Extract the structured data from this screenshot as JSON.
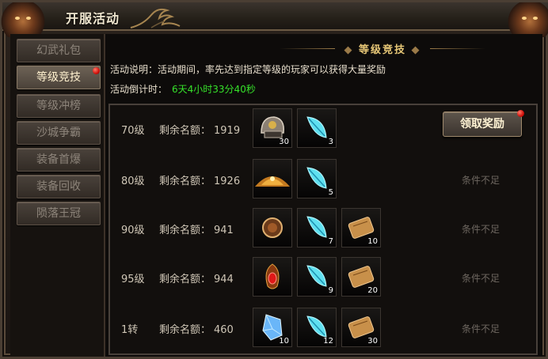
{
  "window": {
    "title": "开服活动"
  },
  "sidebar": {
    "items": [
      {
        "label": "幻武礼包",
        "active": false
      },
      {
        "label": "等级竞技",
        "active": true,
        "badge": true
      },
      {
        "label": "等级冲榜",
        "active": false
      },
      {
        "label": "沙城争霸",
        "active": false
      },
      {
        "label": "装备首爆",
        "active": false
      },
      {
        "label": "装备回收",
        "active": false
      },
      {
        "label": "陨落王冠",
        "active": false
      }
    ]
  },
  "panel": {
    "heading": "等级竞技",
    "description": "活动说明：活动期间，率先达到指定等级的玩家可以获得大量奖励",
    "countdown_label": "活动倒计时：",
    "countdown_value": "6天4小时33分40秒"
  },
  "rows": [
    {
      "level": "70级",
      "quota_label": "剩余名额：",
      "quota": "1919",
      "rewards": [
        {
          "icon": "helmet-icon",
          "count": "30"
        },
        {
          "icon": "feather-icon",
          "count": "3"
        }
      ],
      "action": {
        "type": "button",
        "label": "领取奖励",
        "badge": true
      }
    },
    {
      "level": "80级",
      "quota_label": "剩余名额：",
      "quota": "1926",
      "rewards": [
        {
          "icon": "sand-pile-icon",
          "count": ""
        },
        {
          "icon": "feather-icon",
          "count": "5"
        }
      ],
      "action": {
        "type": "text",
        "label": "条件不足"
      }
    },
    {
      "level": "90级",
      "quota_label": "剩余名额：",
      "quota": "941",
      "rewards": [
        {
          "icon": "orb-icon",
          "count": ""
        },
        {
          "icon": "feather-icon",
          "count": "7"
        },
        {
          "icon": "scroll-icon",
          "count": "10"
        }
      ],
      "action": {
        "type": "text",
        "label": "条件不足"
      }
    },
    {
      "level": "95级",
      "quota_label": "剩余名额：",
      "quota": "944",
      "rewards": [
        {
          "icon": "ruby-amulet-icon",
          "count": ""
        },
        {
          "icon": "feather-icon",
          "count": "9"
        },
        {
          "icon": "scroll-icon",
          "count": "20"
        }
      ],
      "action": {
        "type": "text",
        "label": "条件不足"
      }
    },
    {
      "level": "1转",
      "quota_label": "剩余名额：",
      "quota": "460",
      "rewards": [
        {
          "icon": "crystal-icon",
          "count": "10"
        },
        {
          "icon": "feather-icon",
          "count": "12"
        },
        {
          "icon": "scroll-icon",
          "count": "30"
        }
      ],
      "action": {
        "type": "text",
        "label": "条件不足"
      }
    }
  ],
  "colors": {
    "countdown": "#36e22a",
    "heading": "#e8c877",
    "badge": "#d0100a"
  }
}
